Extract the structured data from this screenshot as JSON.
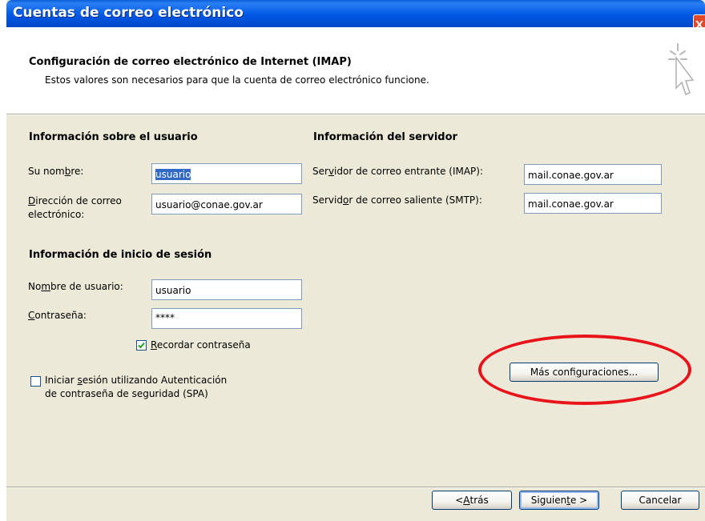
{
  "window": {
    "title": "Cuentas de correo electrónico",
    "close_glyph": "X"
  },
  "header": {
    "title": "Configuración de correo electrónico de Internet (IMAP)",
    "subtitle": "Estos valores son necesarios para que la cuenta de correo electrónico funcione.",
    "icon": "cursor-sparkle-icon"
  },
  "user_info": {
    "heading": "Información sobre el usuario",
    "name_label_pre": "Su nom",
    "name_label_key": "b",
    "name_label_post": "re:",
    "name_value": "usuario",
    "email_label_key": "D",
    "email_label_line1": "irección de correo",
    "email_label_line2": "electrónico:",
    "email_value": "usuario@conae.gov.ar"
  },
  "server_info": {
    "heading": "Información del servidor",
    "incoming_pre": "Ser",
    "incoming_key": "v",
    "incoming_post": "idor de correo entrante (IMAP):",
    "incoming_value": "mail.conae.gov.ar",
    "outgoing_pre": "Servid",
    "outgoing_key": "o",
    "outgoing_post": "r de correo saliente (SMTP):",
    "outgoing_value": "mail.conae.gov.ar"
  },
  "login_info": {
    "heading": "Información de inicio de sesión",
    "username_pre": "No",
    "username_key": "m",
    "username_post": "bre de usuario:",
    "username_value": "usuario",
    "password_key": "C",
    "password_post": "ontraseña:",
    "password_value": "****",
    "remember_key": "R",
    "remember_post": "ecordar contraseña",
    "remember_checked": true,
    "spa_pre": "Iniciar ",
    "spa_key": "s",
    "spa_line1_post": "esión utilizando Autenticación",
    "spa_line2": "de contraseña de seguridad (SPA)",
    "spa_checked": false
  },
  "buttons": {
    "more_pre": "Más confi",
    "more_key": "g",
    "more_post": "uraciones...",
    "back_pre": "< ",
    "back_key": "A",
    "back_post": "trás",
    "next_pre": "Siguien",
    "next_key": "t",
    "next_post": "e >",
    "cancel": "Cancelar"
  },
  "colors": {
    "titlebar": "#0058e6",
    "dialog_bg": "#ece9d8",
    "selection": "#316ac5",
    "annotation": "#e8141a"
  }
}
